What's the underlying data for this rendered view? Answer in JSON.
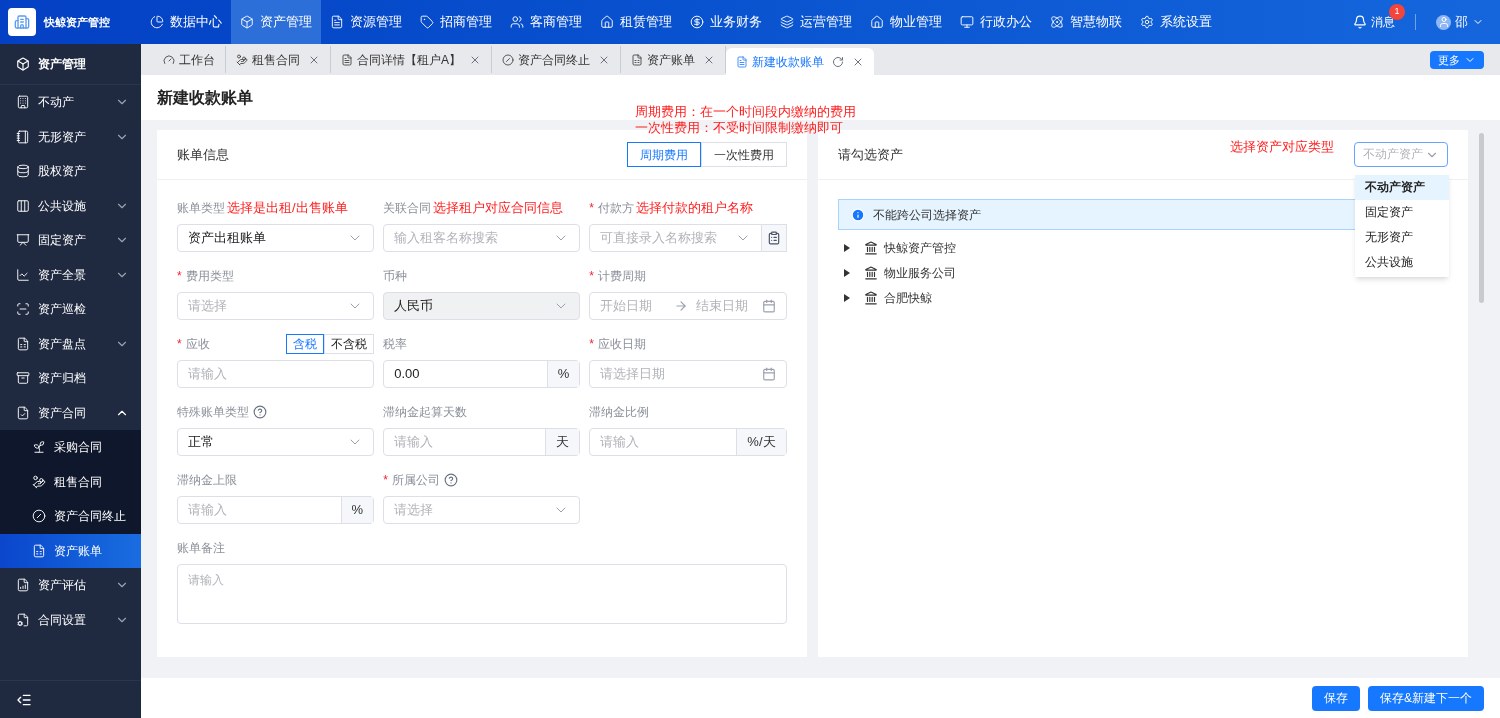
{
  "app": {
    "name": "快鲸资产管控"
  },
  "top_nav": [
    {
      "label": "数据中心",
      "selected": false
    },
    {
      "label": "资产管理",
      "selected": true
    },
    {
      "label": "资源管理",
      "selected": false
    },
    {
      "label": "招商管理",
      "selected": false
    },
    {
      "label": "客商管理",
      "selected": false
    },
    {
      "label": "租赁管理",
      "selected": false
    },
    {
      "label": "业务财务",
      "selected": false
    },
    {
      "label": "运营管理",
      "selected": false
    },
    {
      "label": "物业管理",
      "selected": false
    },
    {
      "label": "行政办公",
      "selected": false
    },
    {
      "label": "智慧物联",
      "selected": false
    },
    {
      "label": "系统设置",
      "selected": false
    }
  ],
  "header": {
    "messages": {
      "label": "消息",
      "badge": "1"
    },
    "user": "邵"
  },
  "sidebar": {
    "title": "资产管理",
    "items": [
      {
        "label": "不动产",
        "expandable": true,
        "expanded": false
      },
      {
        "label": "无形资产",
        "expandable": true,
        "expanded": false
      },
      {
        "label": "股权资产",
        "expandable": false
      },
      {
        "label": "公共设施",
        "expandable": true,
        "expanded": false
      },
      {
        "label": "固定资产",
        "expandable": true,
        "expanded": false
      },
      {
        "label": "资产全景",
        "expandable": true,
        "expanded": false
      },
      {
        "label": "资产巡检",
        "expandable": false
      },
      {
        "label": "资产盘点",
        "expandable": true,
        "expanded": false
      },
      {
        "label": "资产归档",
        "expandable": false
      },
      {
        "label": "资产合同",
        "expandable": true,
        "expanded": true,
        "children": [
          {
            "label": "采购合同",
            "selected": false
          },
          {
            "label": "租售合同",
            "selected": false
          },
          {
            "label": "资产合同终止",
            "selected": false
          },
          {
            "label": "资产账单",
            "selected": true
          }
        ]
      },
      {
        "label": "资产评估",
        "expandable": true,
        "expanded": false
      },
      {
        "label": "合同设置",
        "expandable": true,
        "expanded": false
      }
    ]
  },
  "tabs": [
    {
      "label": "工作台",
      "selected": false,
      "closable": false
    },
    {
      "label": "租售合同",
      "selected": false,
      "closable": true
    },
    {
      "label": "合同详情【租户A】",
      "selected": false,
      "closable": true
    },
    {
      "label": "资产合同终止",
      "selected": false,
      "closable": true
    },
    {
      "label": "资产账单",
      "selected": false,
      "closable": true
    },
    {
      "label": "新建收款账单",
      "selected": true,
      "closable": true
    }
  ],
  "more_button": "更多",
  "page_title": "新建收款账单",
  "required_mark": "*",
  "note": [
    "周期费用：在一个时间段内缴纳的费用",
    "一次性费用：不受时间限制缴纳即可"
  ],
  "bill_card": {
    "title": "账单信息",
    "fee_modes": [
      {
        "label": "周期费用",
        "selected": true
      },
      {
        "label": "一次性费用",
        "selected": false
      }
    ],
    "fields": [
      {
        "label": "账单类型",
        "kind": "select",
        "required": false,
        "help": false,
        "annotation": "选择是出租/出售账单",
        "value": "资产出租账单",
        "disabled": false
      },
      {
        "label": "关联合同",
        "kind": "select",
        "required": false,
        "help": false,
        "annotation": "选择租户对应合同信息",
        "placeholder": "输入租客名称搜索",
        "disabled": false
      },
      {
        "label": "付款方",
        "kind": "select-button",
        "required": true,
        "help": false,
        "annotation": "选择付款的租户名称",
        "placeholder": "可直接录入名称搜索",
        "disabled": false
      },
      {
        "label": "费用类型",
        "kind": "select",
        "required": true,
        "help": false,
        "placeholder": "请选择",
        "disabled": false
      },
      {
        "label": "币种",
        "kind": "select",
        "required": false,
        "help": false,
        "value": "人民币",
        "disabled": true
      },
      {
        "label": "计费周期",
        "kind": "date-range",
        "required": true,
        "help": false,
        "start_placeholder": "开始日期",
        "end_placeholder": "结束日期",
        "disabled": false
      },
      {
        "label": "应收",
        "kind": "input",
        "required": true,
        "help": false,
        "placeholder": "请输入",
        "disabled": false,
        "tax_toggle": [
          {
            "label": "含税",
            "selected": true
          },
          {
            "label": "不含税",
            "selected": false
          }
        ]
      },
      {
        "label": "税率",
        "kind": "addon",
        "required": false,
        "help": false,
        "value": "0.00",
        "addon": "%",
        "disabled": false
      },
      {
        "label": "应收日期",
        "kind": "date",
        "required": true,
        "help": false,
        "placeholder": "请选择日期",
        "disabled": false
      },
      {
        "label": "特殊账单类型",
        "kind": "select",
        "required": false,
        "help": true,
        "value": "正常",
        "disabled": false
      },
      {
        "label": "滞纳金起算天数",
        "kind": "addon",
        "required": false,
        "help": false,
        "placeholder": "请输入",
        "addon": "天",
        "disabled": false
      },
      {
        "label": "滞纳金比例",
        "kind": "addon",
        "required": false,
        "help": false,
        "placeholder": "请输入",
        "addon": "%/天",
        "disabled": false
      },
      {
        "label": "滞纳金上限",
        "kind": "addon",
        "required": false,
        "help": false,
        "placeholder": "请输入",
        "addon": "%",
        "disabled": false
      },
      {
        "label": "所属公司",
        "kind": "select",
        "required": true,
        "help": true,
        "placeholder": "请选择",
        "disabled": false
      }
    ],
    "remark": {
      "label": "账单备注",
      "placeholder": "请输入"
    }
  },
  "asset_card": {
    "title": "请勾选资产",
    "annotation": "选择资产对应类型",
    "type_select": {
      "placeholder": "不动产资产",
      "open": true
    },
    "type_options": [
      {
        "label": "不动产资产",
        "selected": true
      },
      {
        "label": "固定资产",
        "selected": false
      },
      {
        "label": "无形资产",
        "selected": false
      },
      {
        "label": "公共设施",
        "selected": false
      }
    ],
    "notice": "不能跨公司选择资产",
    "tree": [
      {
        "label": "快鲸资产管控",
        "expanded": false
      },
      {
        "label": "物业服务公司",
        "expanded": false
      },
      {
        "label": "合肥快鲸",
        "expanded": false
      }
    ]
  },
  "footer_buttons": [
    {
      "label": "保存",
      "kind": "primary"
    },
    {
      "label": "保存&新建下一个",
      "kind": "primary"
    }
  ]
}
